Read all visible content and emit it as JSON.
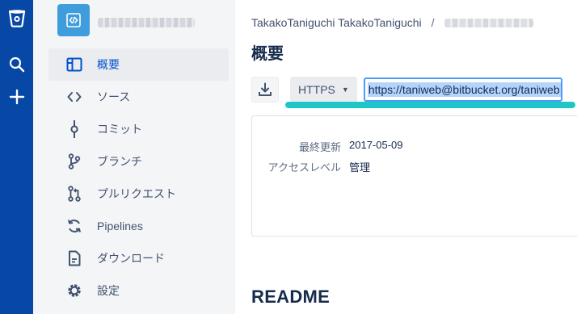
{
  "global_nav": {
    "icons": [
      "bitbucket-logo-icon",
      "search-icon",
      "plus-icon"
    ]
  },
  "sidebar": {
    "items": [
      {
        "label": "概要",
        "icon": "overview-icon",
        "active": true
      },
      {
        "label": "ソース",
        "icon": "code-icon",
        "active": false
      },
      {
        "label": "コミット",
        "icon": "commit-icon",
        "active": false
      },
      {
        "label": "ブランチ",
        "icon": "branch-icon",
        "active": false
      },
      {
        "label": "プルリクエスト",
        "icon": "pull-request-icon",
        "active": false
      },
      {
        "label": "Pipelines",
        "icon": "pipelines-icon",
        "active": false
      },
      {
        "label": "ダウンロード",
        "icon": "download-file-icon",
        "active": false
      },
      {
        "label": "設定",
        "icon": "gear-icon",
        "active": false
      }
    ]
  },
  "breadcrumb": {
    "owner": "TakakoTaniguchi TakakoTaniguchi",
    "separator": "/"
  },
  "main": {
    "title": "概要",
    "clone": {
      "protocol": "HTTPS",
      "url": "https://taniweb@bitbucket.org/taniweb"
    },
    "info": [
      {
        "key": "最終更新",
        "value": "2017-05-09"
      },
      {
        "key": "アクセスレベル",
        "value": "管理"
      }
    ],
    "readme_title": "README"
  },
  "colors": {
    "global_nav": "#0747a6",
    "sidebar_bg": "#f4f5f7",
    "active_text": "#0052cc",
    "url_focus": "#4c9aff",
    "highlight": "#1ec6c8"
  }
}
